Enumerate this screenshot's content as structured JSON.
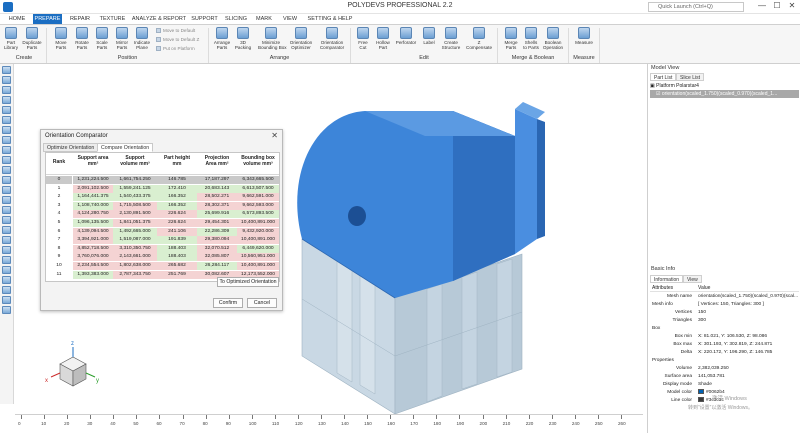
{
  "app": {
    "title": "POLYDEVS PROFESSIONAL 2.2",
    "quick_launch_placeholder": "Quick Launch (Ctrl+Q)"
  },
  "window_controls": {
    "minimize": "—",
    "maximize": "☐",
    "close": "✕"
  },
  "menu_tabs": [
    "HOME",
    "PREPARE",
    "REPAIR",
    "TEXTURE",
    "ANALYZE & REPORT",
    "SUPPORT",
    "SLICING",
    "MARK",
    "VIEW",
    "SETTING & HELP"
  ],
  "active_tab": "PREPARE",
  "ribbon": {
    "buttons": [
      {
        "label": "Part\nLibrary",
        "icon": "part-library-icon"
      },
      {
        "label": "Duplicate\nParts",
        "icon": "duplicate-icon"
      },
      {
        "label": "Move\nParts",
        "icon": "move-icon"
      },
      {
        "label": "Rotate\nParts",
        "icon": "rotate-icon"
      },
      {
        "label": "Scale\nParts",
        "icon": "scale-icon"
      },
      {
        "label": "Mirror\nParts",
        "icon": "mirror-icon"
      },
      {
        "label": "Indicate\nPlane",
        "icon": "plane-icon"
      },
      {
        "label": "Arrange\nParts",
        "icon": "arrange-icon"
      },
      {
        "label": "3D\nPacking",
        "icon": "packing-icon"
      },
      {
        "label": "Minimize\nBounding Box",
        "icon": "bounding-box-icon"
      },
      {
        "label": "Orientation\nOptimizer",
        "icon": "orientation-optimizer-icon"
      },
      {
        "label": "Orientation\nComparator",
        "icon": "orientation-comparator-icon"
      },
      {
        "label": "Free\nCut",
        "icon": "free-cut-icon"
      },
      {
        "label": "Hollow\nPart",
        "icon": "hollow-icon"
      },
      {
        "label": "Perforator",
        "icon": "perforator-icon"
      },
      {
        "label": "Label",
        "icon": "label-icon"
      },
      {
        "label": "Create\nStructure",
        "icon": "structure-icon"
      },
      {
        "label": "Z\nCompensate",
        "icon": "z-compensate-icon"
      },
      {
        "label": "Merge\nParts",
        "icon": "merge-icon"
      },
      {
        "label": "Shells\nto Parts",
        "icon": "shells-icon"
      },
      {
        "label": "Boolean\nOperation",
        "icon": "boolean-icon"
      },
      {
        "label": "Measure",
        "icon": "measure-icon"
      }
    ],
    "small_buttons": [
      "Move to Default",
      "Move to Default Z",
      "Put on Platform"
    ],
    "groups": [
      "Create",
      "Position",
      "Arrange",
      "Edit",
      "Merge & Boolean",
      "Measure"
    ]
  },
  "orientation_dialog": {
    "title": "Orientation Comparator",
    "tabs": [
      "Optimize Orientation",
      "Compare Orientation"
    ],
    "active_tab": "Compare Orientation",
    "columns": [
      {
        "label": "Rank",
        "unit": ""
      },
      {
        "label": "Support area",
        "unit": "mm²"
      },
      {
        "label": "Support\nvolume mm³",
        "unit": ""
      },
      {
        "label": "Part height",
        "unit": "mm"
      },
      {
        "label": "Projection\nArea mm²",
        "unit": ""
      },
      {
        "label": "Bounding box\nvolume mm³",
        "unit": ""
      }
    ],
    "rows": [
      [
        "0",
        "1,231,224.500",
        "1,661,754.250",
        "146.785",
        "17,187.297",
        "6,343,665.500"
      ],
      [
        "1",
        "2,091,102.500",
        "1,559,241.125",
        "172.410",
        "20,683.143",
        "6,613,507.500"
      ],
      [
        "2",
        "1,164,441.375",
        "1,540,433.375",
        "166.352",
        "28,502.271",
        "9,662,591.000"
      ],
      [
        "3",
        "1,108,740.000",
        "1,715,508.500",
        "166.352",
        "28,302.371",
        "9,662,593.000"
      ],
      [
        "4",
        "4,124,280.750",
        "2,130,891.500",
        "226.624",
        "25,699.916",
        "6,573,893.500"
      ],
      [
        "5",
        "1,096,135.500",
        "1,841,051.375",
        "226.624",
        "29,454.301",
        "10,400,891.000"
      ],
      [
        "6",
        "4,139,094.500",
        "1,492,665.000",
        "241.106",
        "22,286.309",
        "9,432,920.000"
      ],
      [
        "7",
        "3,394,921.000",
        "1,519,087.000",
        "191.839",
        "29,380.094",
        "10,400,891.000"
      ],
      [
        "8",
        "4,852,718.500",
        "3,310,350.750",
        "188.403",
        "32,070.512",
        "6,449,620.000"
      ],
      [
        "9",
        "3,760,076.000",
        "2,143,661.000",
        "188.403",
        "32,085.807",
        "10,560,951.000"
      ],
      [
        "10",
        "2,234,554.500",
        "1,802,638.000",
        "265.682",
        "26,284.117",
        "10,400,891.000"
      ],
      [
        "11",
        "1,393,383.000",
        "2,787,343.750",
        "251.769",
        "30,082.607",
        "12,173,552.000"
      ]
    ],
    "row_colors": {
      "selected": "#c9c9c9",
      "good": "#d9efd0",
      "bad": "#f4d3d3"
    },
    "cell_quality": [
      [
        "sel",
        "sel",
        "sel",
        "sel",
        "sel"
      ],
      [
        "bad",
        "good",
        "good",
        "good",
        "good"
      ],
      [
        "good",
        "good",
        "good",
        "bad",
        "bad"
      ],
      [
        "good",
        "bad",
        "good",
        "bad",
        "bad"
      ],
      [
        "bad",
        "bad",
        "bad",
        "good",
        "good"
      ],
      [
        "good",
        "bad",
        "bad",
        "bad",
        "bad"
      ],
      [
        "bad",
        "good",
        "bad",
        "good",
        "bad"
      ],
      [
        "bad",
        "good",
        "good",
        "bad",
        "bad"
      ],
      [
        "bad",
        "bad",
        "good",
        "bad",
        "good"
      ],
      [
        "bad",
        "bad",
        "good",
        "bad",
        "bad"
      ],
      [
        "bad",
        "bad",
        "bad",
        "good",
        "bad"
      ],
      [
        "good",
        "bad",
        "bad",
        "bad",
        "bad"
      ]
    ],
    "to_optimized_label": "To Optimized Orientation",
    "confirm_label": "Confirm",
    "cancel_label": "Cancel"
  },
  "ruler": {
    "numbers": [
      "0",
      "10",
      "20",
      "30",
      "40",
      "50",
      "60",
      "70",
      "80",
      "90",
      "100",
      "110",
      "120",
      "130",
      "140",
      "150",
      "160",
      "170",
      "180",
      "190",
      "200",
      "210",
      "220",
      "230",
      "240",
      "250",
      "260"
    ]
  },
  "axis_labels": {
    "x": "x",
    "y": "y",
    "z": "z"
  },
  "model_view": {
    "title": "Model View",
    "tabs": [
      "Part List",
      "Slice List"
    ],
    "active_tab": "Part List",
    "tree": [
      "Platform Polarstar4",
      "orientation(scaled_1.750)(scaled_0.970)(scaled_1..."
    ]
  },
  "basic_info": {
    "title": "Basic Info",
    "tabs": [
      "Information",
      "View"
    ],
    "active_tab": "Information",
    "headers": [
      "Attributes",
      "Value"
    ],
    "rows": [
      {
        "k": "Mesh name",
        "v": "orientation(scaled_1.750)(scaled_0.970)(scal..."
      },
      {
        "k": "Mesh info",
        "v": "[ Vertices: 150, Triangles: 300 ]",
        "section": true
      },
      {
        "k": "Vertices",
        "v": "150"
      },
      {
        "k": "Triangles",
        "v": "300"
      },
      {
        "k": "Box",
        "v": "",
        "section": true
      },
      {
        "k": "Box min",
        "v": "X: 81.021, Y: 106.530, Z: 98.086"
      },
      {
        "k": "Box max",
        "v": "X: 301.193, Y: 302.819, Z: 244.871"
      },
      {
        "k": "Delta",
        "v": "X: 220.172, Y: 196.290, Z: 146.785"
      },
      {
        "k": "Properties",
        "v": "",
        "section": true
      },
      {
        "k": "Volume",
        "v": "2,382,039.250"
      },
      {
        "k": "Surface area",
        "v": "141,053.781"
      },
      {
        "k": "Display mode",
        "v": "Shade"
      },
      {
        "k": "Model color",
        "v": "#0062b4",
        "swatch": "#0062b4"
      },
      {
        "k": "Line color",
        "v": "#3c3c3c",
        "swatch": "#3c3c3c"
      }
    ]
  },
  "watermark": {
    "line1": "激活 Windows",
    "line2": "转到“设置”以激活 Windows。"
  },
  "colors": {
    "accent": "#1b6ec2",
    "model_blue": "#3d85d9",
    "support_gray": "#b9cbd8"
  }
}
